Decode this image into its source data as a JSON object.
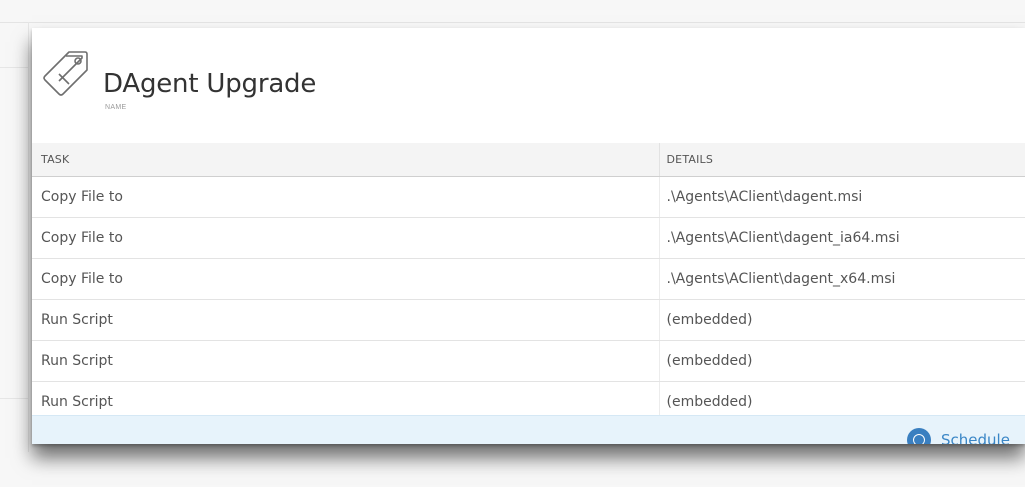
{
  "dialog": {
    "title": "DAgent Upgrade",
    "title_caption": "NAME",
    "icon": "tag-icon"
  },
  "table": {
    "columns": [
      "TASK",
      "DETAILS"
    ],
    "rows": [
      {
        "task": "Copy File to",
        "details": ".\\Agents\\AClient\\dagent.msi"
      },
      {
        "task": "Copy File to",
        "details": ".\\Agents\\AClient\\dagent_ia64.msi"
      },
      {
        "task": "Copy File to",
        "details": ".\\Agents\\AClient\\dagent_x64.msi"
      },
      {
        "task": "Run Script",
        "details": "(embedded)"
      },
      {
        "task": "Run Script",
        "details": "(embedded)"
      },
      {
        "task": "Run Script",
        "details": "(embedded)"
      }
    ]
  },
  "footer": {
    "schedule_label": "Schedule",
    "schedule_icon": "schedule-icon",
    "background_color": "#e7f3fb",
    "accent_color": "#3a86c6"
  }
}
